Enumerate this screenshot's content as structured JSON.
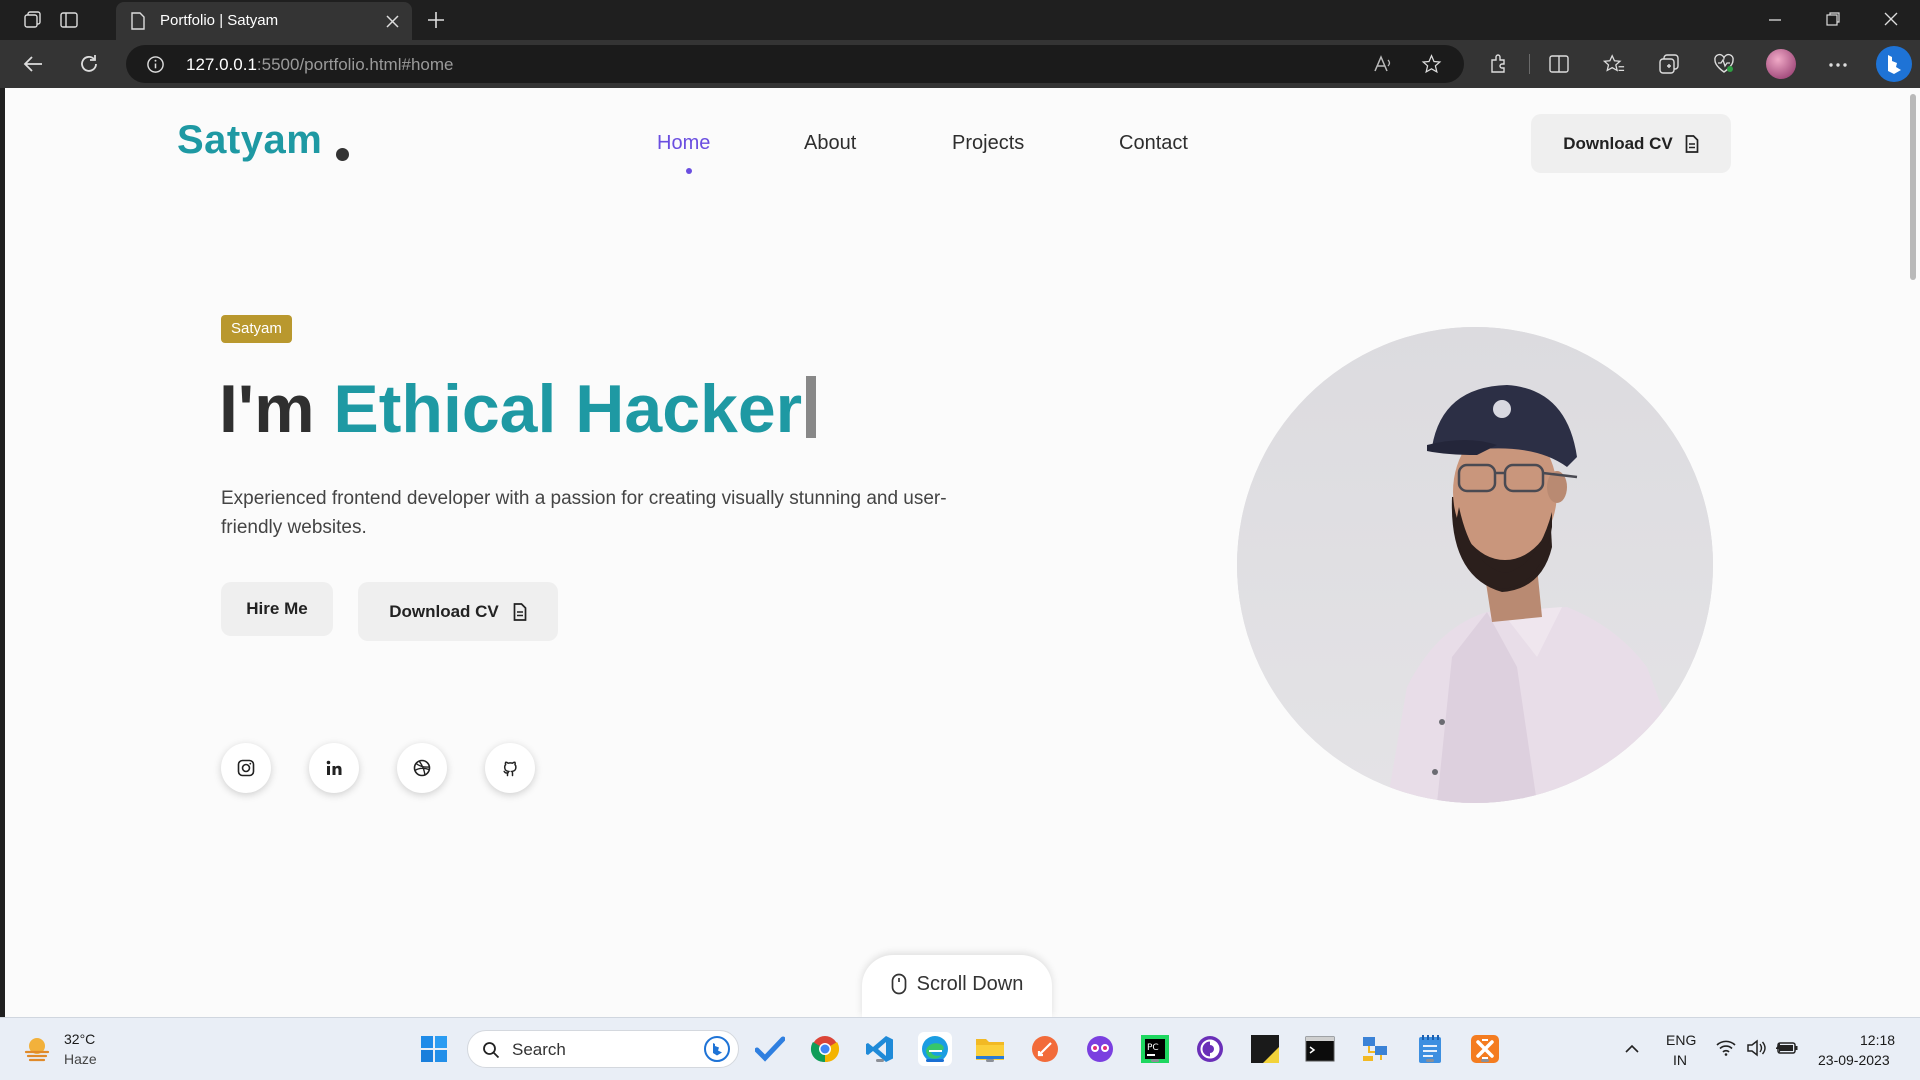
{
  "browser": {
    "tab_title": "Portfolio | Satyam",
    "url_host": "127.0.0.1",
    "url_rest": ":5500/portfolio.html#home"
  },
  "site": {
    "logo": "Satyam",
    "nav": [
      "Home",
      "About",
      "Projects",
      "Contact"
    ],
    "active_nav": "Home",
    "header_cv": "Download CV",
    "badge": "Satyam",
    "headline_prefix": "I'm ",
    "headline_role": "Ethical Hacker",
    "description": "Experienced frontend developer with a passion for creating visually stunning and user-friendly websites.",
    "hire_btn": "Hire Me",
    "download_btn": "Download CV",
    "socials": [
      "instagram-icon",
      "linkedin-icon",
      "dribbble-icon",
      "github-icon"
    ],
    "scroll_down": "Scroll Down",
    "colors": {
      "accent": "#1e99a3",
      "nav_active": "#6a4ee0",
      "badge": "#b9982e"
    }
  },
  "taskbar": {
    "weather_temp": "32°C",
    "weather_desc": "Haze",
    "search_placeholder": "Search",
    "lang_top": "ENG",
    "lang_bottom": "IN",
    "time": "12:18",
    "date": "23-09-2023"
  }
}
